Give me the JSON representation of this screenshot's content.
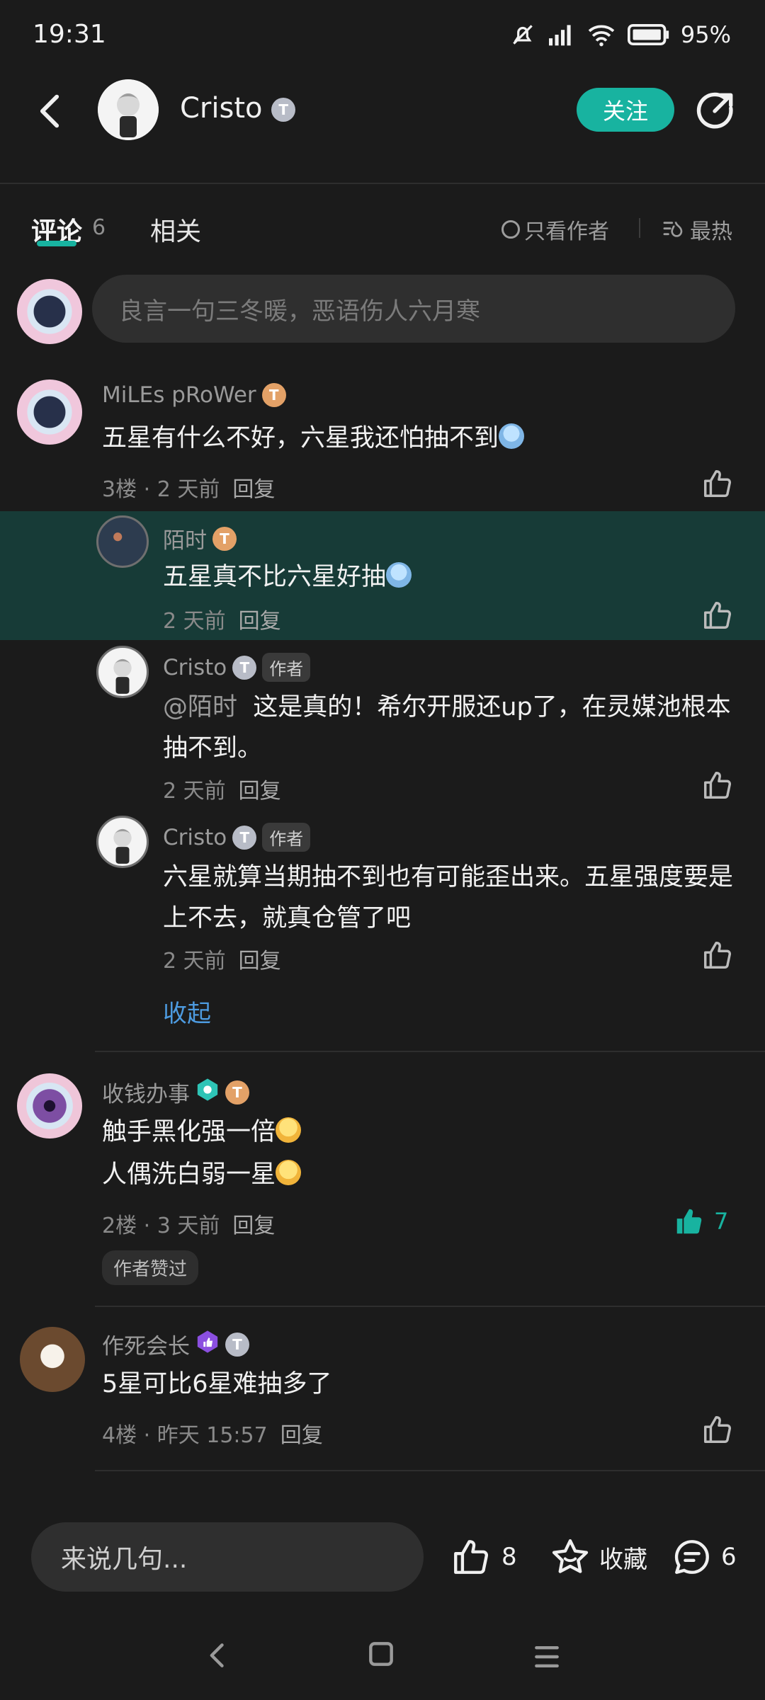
{
  "status": {
    "time": "19:31",
    "battery": "95%"
  },
  "header": {
    "user_name": "Cristo",
    "follow_label": "关注",
    "badge_letter": "T"
  },
  "tabs": {
    "comments_label": "评论",
    "comments_count": "6",
    "related_label": "相关",
    "author_only_label": "只看作者",
    "sort_label": "最热"
  },
  "composer": {
    "placeholder": "良言一句三冬暖，恶语伤人六月寒"
  },
  "comments": [
    {
      "name": "MiLEs pRoWer",
      "text": "五星有什么不好，六星我还怕抽不到",
      "floor": "3楼",
      "time": "2 天前",
      "reply_label": "回复",
      "replies": [
        {
          "name": "陌时",
          "text": "五星真不比六星好抽",
          "time": "2 天前",
          "reply_label": "回复"
        },
        {
          "name": "Cristo",
          "tag": "作者",
          "mention": "@陌时",
          "text": "这是真的！希尔开服还up了，在灵媒池根本抽不到。",
          "time": "2 天前",
          "reply_label": "回复"
        },
        {
          "name": "Cristo",
          "tag": "作者",
          "text": "六星就算当期抽不到也有可能歪出来。五星强度要是上不去，就真仓管了吧",
          "time": "2 天前",
          "reply_label": "回复"
        }
      ],
      "collapse_label": "收起"
    },
    {
      "name": "收钱办事",
      "text_line1": "触手黑化强一倍",
      "text_line2": "人偶洗白弱一星",
      "floor": "2楼",
      "time": "3 天前",
      "reply_label": "回复",
      "like_count": "7",
      "author_liked_label": "作者赞过"
    },
    {
      "name": "作死会长",
      "text": "5星可比6星难抽多了",
      "floor": "4楼",
      "time": "昨天 15:57",
      "reply_label": "回复"
    }
  ],
  "bottom_bar": {
    "input_placeholder": "来说几句...",
    "like_count": "8",
    "favorite_label": "收藏",
    "comment_count": "6"
  },
  "colors": {
    "accent": "#18b3a0",
    "highlight": "#173b37",
    "link": "#4d9be0",
    "background": "#1b1b1b"
  }
}
